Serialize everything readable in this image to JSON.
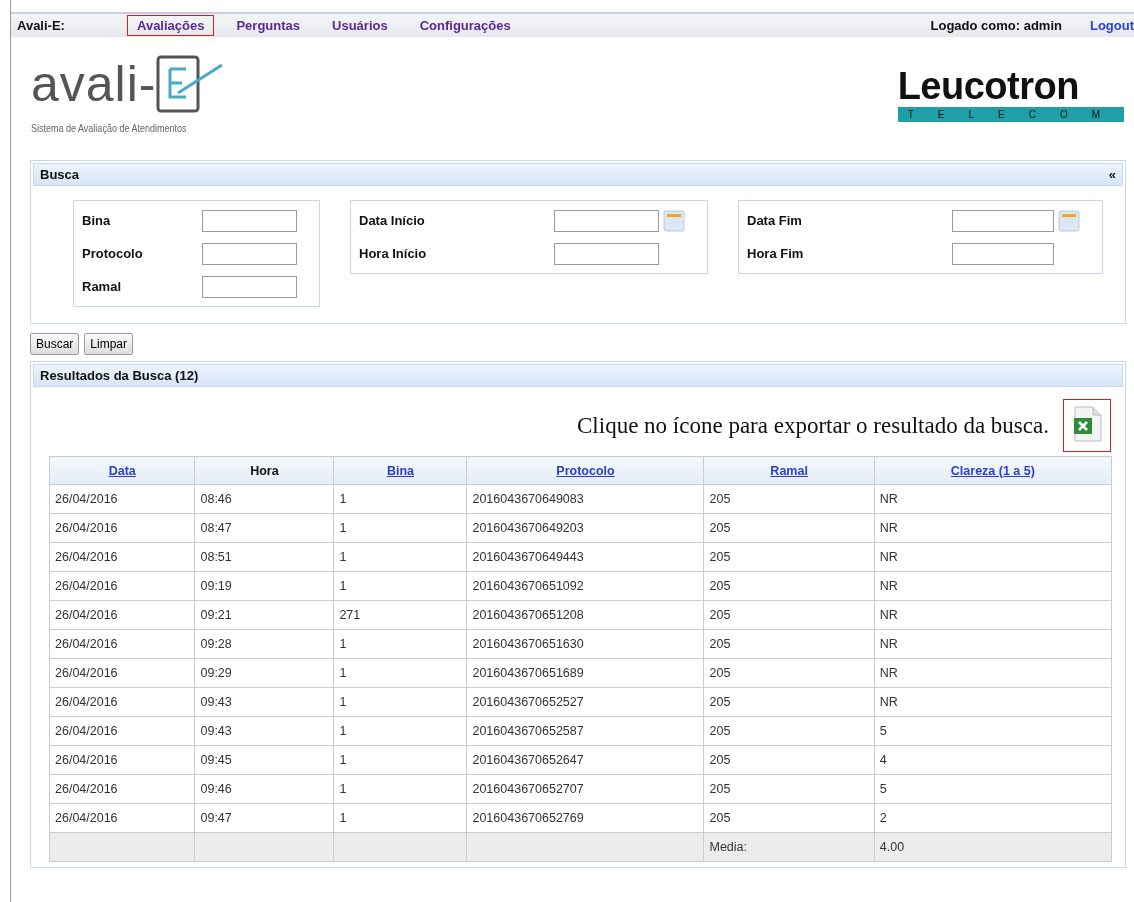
{
  "nav": {
    "brand": "Avali-E:",
    "items": [
      {
        "label": "Avaliações",
        "highlighted": true
      },
      {
        "label": "Perguntas",
        "highlighted": false
      },
      {
        "label": "Usuários",
        "highlighted": false
      },
      {
        "label": "Configurações",
        "highlighted": false
      }
    ],
    "user": "Logado como: admin",
    "logout": "Logout"
  },
  "logo": {
    "text": "avali-",
    "subtitle": "Sistema de Avaliação de Atendimentos"
  },
  "partner_logo": {
    "name": "Leucotron",
    "tagline": "TELECOM"
  },
  "search": {
    "title": "Busca",
    "collapse": "«",
    "groups": [
      {
        "fields": [
          {
            "label": "Bina",
            "kind": "text"
          },
          {
            "label": "Protocolo",
            "kind": "text"
          },
          {
            "label": "Ramal",
            "kind": "text"
          }
        ]
      },
      {
        "fields": [
          {
            "label": "Data Início",
            "kind": "date"
          },
          {
            "label": "Hora Início",
            "kind": "text"
          }
        ]
      },
      {
        "fields": [
          {
            "label": "Data Fim",
            "kind": "date"
          },
          {
            "label": "Hora Fim",
            "kind": "text"
          }
        ]
      }
    ],
    "buttons": [
      "Buscar",
      "Limpar"
    ]
  },
  "results": {
    "title": "Resultados da Busca (12)",
    "export_hint": "Clique no ícone para exportar o resultado da busca.",
    "export_highlighted": true,
    "table": {
      "columns": [
        {
          "label": "Data",
          "sortable": true
        },
        {
          "label": "Hora",
          "sortable": false
        },
        {
          "label": "Bina",
          "sortable": true
        },
        {
          "label": "Protocolo",
          "sortable": true
        },
        {
          "label": "Ramal",
          "sortable": true
        },
        {
          "label": "Clareza (1 a 5)",
          "sortable": true
        }
      ],
      "rows": [
        [
          "26/04/2016",
          "08:46",
          "1",
          "2016043670649083",
          "205",
          "NR"
        ],
        [
          "26/04/2016",
          "08:47",
          "1",
          "2016043670649203",
          "205",
          "NR"
        ],
        [
          "26/04/2016",
          "08:51",
          "1",
          "2016043670649443",
          "205",
          "NR"
        ],
        [
          "26/04/2016",
          "09:19",
          "1",
          "2016043670651092",
          "205",
          "NR"
        ],
        [
          "26/04/2016",
          "09:21",
          "271",
          "2016043670651208",
          "205",
          "NR"
        ],
        [
          "26/04/2016",
          "09:28",
          "1",
          "2016043670651630",
          "205",
          "NR"
        ],
        [
          "26/04/2016",
          "09:29",
          "1",
          "2016043670651689",
          "205",
          "NR"
        ],
        [
          "26/04/2016",
          "09:43",
          "1",
          "2016043670652527",
          "205",
          "NR"
        ],
        [
          "26/04/2016",
          "09:43",
          "1",
          "2016043670652587",
          "205",
          "5"
        ],
        [
          "26/04/2016",
          "09:45",
          "1",
          "2016043670652647",
          "205",
          "4"
        ],
        [
          "26/04/2016",
          "09:46",
          "1",
          "2016043670652707",
          "205",
          "5"
        ],
        [
          "26/04/2016",
          "09:47",
          "1",
          "2016043670652769",
          "205",
          "2"
        ]
      ],
      "footer": {
        "label": "Media:",
        "value": "4.00"
      }
    }
  }
}
